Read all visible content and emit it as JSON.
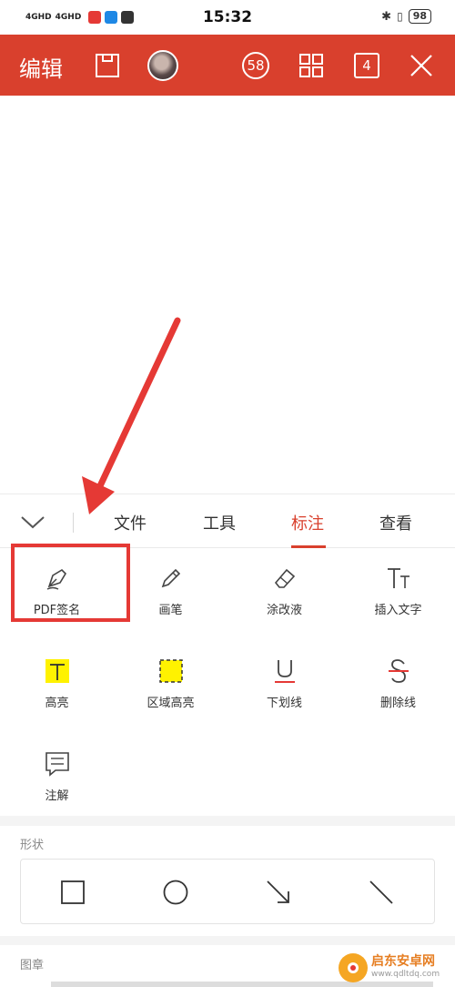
{
  "status_bar": {
    "signal1": "4GHD",
    "signal2": "4GHD",
    "time": "15:32",
    "battery": "98"
  },
  "header": {
    "title": "编辑",
    "page_count": "58",
    "tab_count": "4",
    "color": "#d9402d"
  },
  "tabs": [
    {
      "label": "文件",
      "active": false
    },
    {
      "label": "工具",
      "active": false
    },
    {
      "label": "标注",
      "active": true
    },
    {
      "label": "查看",
      "active": false
    }
  ],
  "tools": [
    {
      "label": "PDF签名",
      "icon": "pen-nib-icon"
    },
    {
      "label": "画笔",
      "icon": "pencil-icon"
    },
    {
      "label": "涂改液",
      "icon": "eraser-icon"
    },
    {
      "label": "插入文字",
      "icon": "text-size-icon"
    },
    {
      "label": "高亮",
      "icon": "highlight-text-icon"
    },
    {
      "label": "区域高亮",
      "icon": "area-highlight-icon"
    },
    {
      "label": "下划线",
      "icon": "underline-icon"
    },
    {
      "label": "删除线",
      "icon": "strikethrough-icon"
    },
    {
      "label": "注解",
      "icon": "comment-icon"
    }
  ],
  "shapes_section": {
    "label": "形状",
    "items": [
      "square-shape-icon",
      "circle-shape-icon",
      "arrow-shape-icon",
      "line-shape-icon"
    ]
  },
  "stamp_section": {
    "label": "图章"
  },
  "watermark": {
    "name": "启东安卓网",
    "url": "www.qdltdq.com"
  }
}
